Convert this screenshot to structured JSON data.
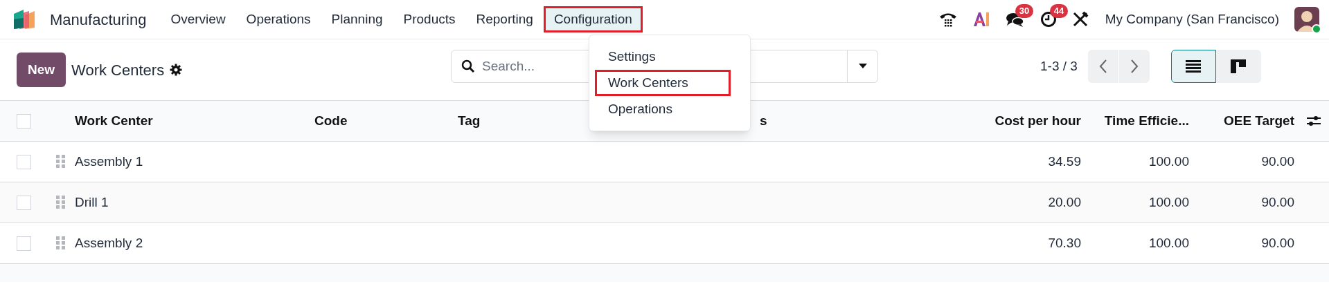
{
  "navbar": {
    "app_name": "Manufacturing",
    "menu": [
      {
        "label": "Overview",
        "selected": false,
        "highlighted": false
      },
      {
        "label": "Operations",
        "selected": false,
        "highlighted": false
      },
      {
        "label": "Planning",
        "selected": false,
        "highlighted": false
      },
      {
        "label": "Products",
        "selected": false,
        "highlighted": false
      },
      {
        "label": "Reporting",
        "selected": false,
        "highlighted": false
      },
      {
        "label": "Configuration",
        "selected": true,
        "highlighted": true
      }
    ],
    "systray": [
      {
        "kind": "phone"
      },
      {
        "kind": "ai"
      },
      {
        "kind": "chat",
        "badge": "30"
      },
      {
        "kind": "activity",
        "badge": "44"
      },
      {
        "kind": "tools"
      }
    ],
    "company": "My Company (San Francisco)",
    "user_online": true
  },
  "dropdown": {
    "items": [
      {
        "label": "Settings",
        "highlighted": false
      },
      {
        "label": "Work Centers",
        "highlighted": true
      },
      {
        "label": "Operations",
        "highlighted": false
      }
    ]
  },
  "control_panel": {
    "new_button": "New",
    "title": "Work Centers",
    "search": {
      "placeholder": "Search..."
    },
    "pager": "1-3 / 3",
    "views": [
      {
        "kind": "list",
        "selected": true
      },
      {
        "kind": "kanban",
        "selected": false
      }
    ]
  },
  "table": {
    "all_checked": false,
    "columns": [
      {
        "label": "Work Center",
        "kind": "text"
      },
      {
        "label": "Code",
        "kind": "text"
      },
      {
        "label": "Tag",
        "kind": "text"
      },
      {
        "label": "s",
        "kind": "text"
      },
      {
        "label": "Cost per hour",
        "kind": "number"
      },
      {
        "label": "Time Efficie...",
        "kind": "number"
      },
      {
        "label": "OEE Target",
        "kind": "number"
      }
    ],
    "rows": [
      {
        "checked": false,
        "cells": [
          "Assembly 1",
          "",
          "",
          "",
          "34.59",
          "100.00",
          "90.00"
        ]
      },
      {
        "checked": false,
        "cells": [
          "Drill 1",
          "",
          "",
          "",
          "20.00",
          "100.00",
          "90.00"
        ]
      },
      {
        "checked": false,
        "cells": [
          "Assembly 2",
          "",
          "",
          "",
          "70.30",
          "100.00",
          "90.00"
        ]
      }
    ]
  }
}
